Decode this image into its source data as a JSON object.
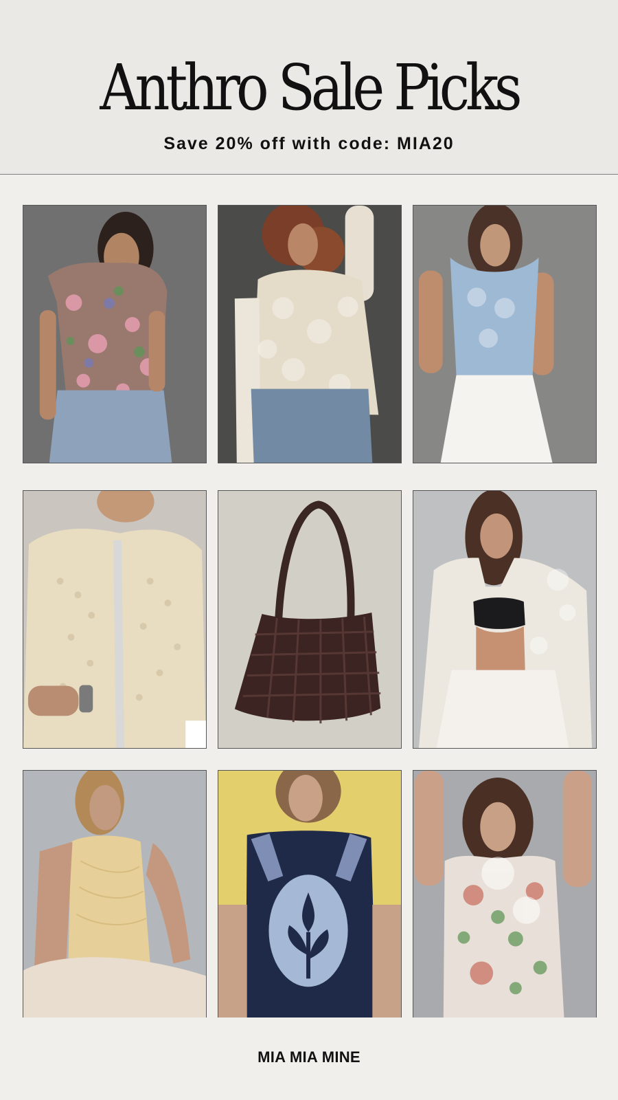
{
  "header": {
    "title": "Anthro Sale Picks",
    "promo": "Save 20% off with code: MIA20"
  },
  "footer": {
    "brand": "MIA MIA MINE"
  }
}
